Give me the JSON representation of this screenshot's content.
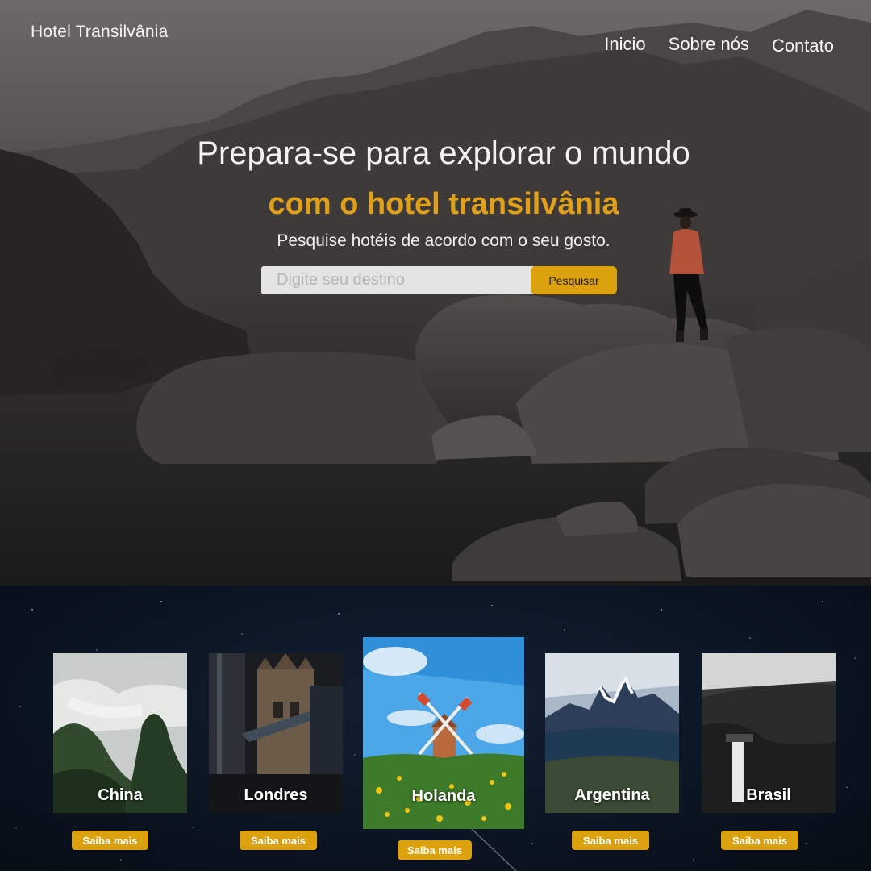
{
  "header": {
    "brand": "Hotel Transilvânia",
    "nav": [
      {
        "label": "Inicio"
      },
      {
        "label": "Sobre nós"
      },
      {
        "label": "Contato"
      }
    ]
  },
  "hero": {
    "headline": "Prepara-se para explorar o mundo",
    "subhead": "com o hotel transilvânia",
    "tagline": "Pesquise hotéis de acordo com o seu gosto.",
    "search": {
      "placeholder": "Digite seu destino",
      "value": "",
      "button_label": "Pesquisar"
    }
  },
  "destinations": [
    {
      "name": "China",
      "button_label": "Saiba mais"
    },
    {
      "name": "Londres",
      "button_label": "Saiba mais"
    },
    {
      "name": "Holanda",
      "button_label": "Saiba mais"
    },
    {
      "name": "Argentina",
      "button_label": "Saiba mais"
    },
    {
      "name": "Brasil",
      "button_label": "Saiba mais"
    }
  ],
  "colors": {
    "accent": "#dba10f",
    "subhead": "#e0a01a",
    "footer_bg": "#0b1421"
  }
}
